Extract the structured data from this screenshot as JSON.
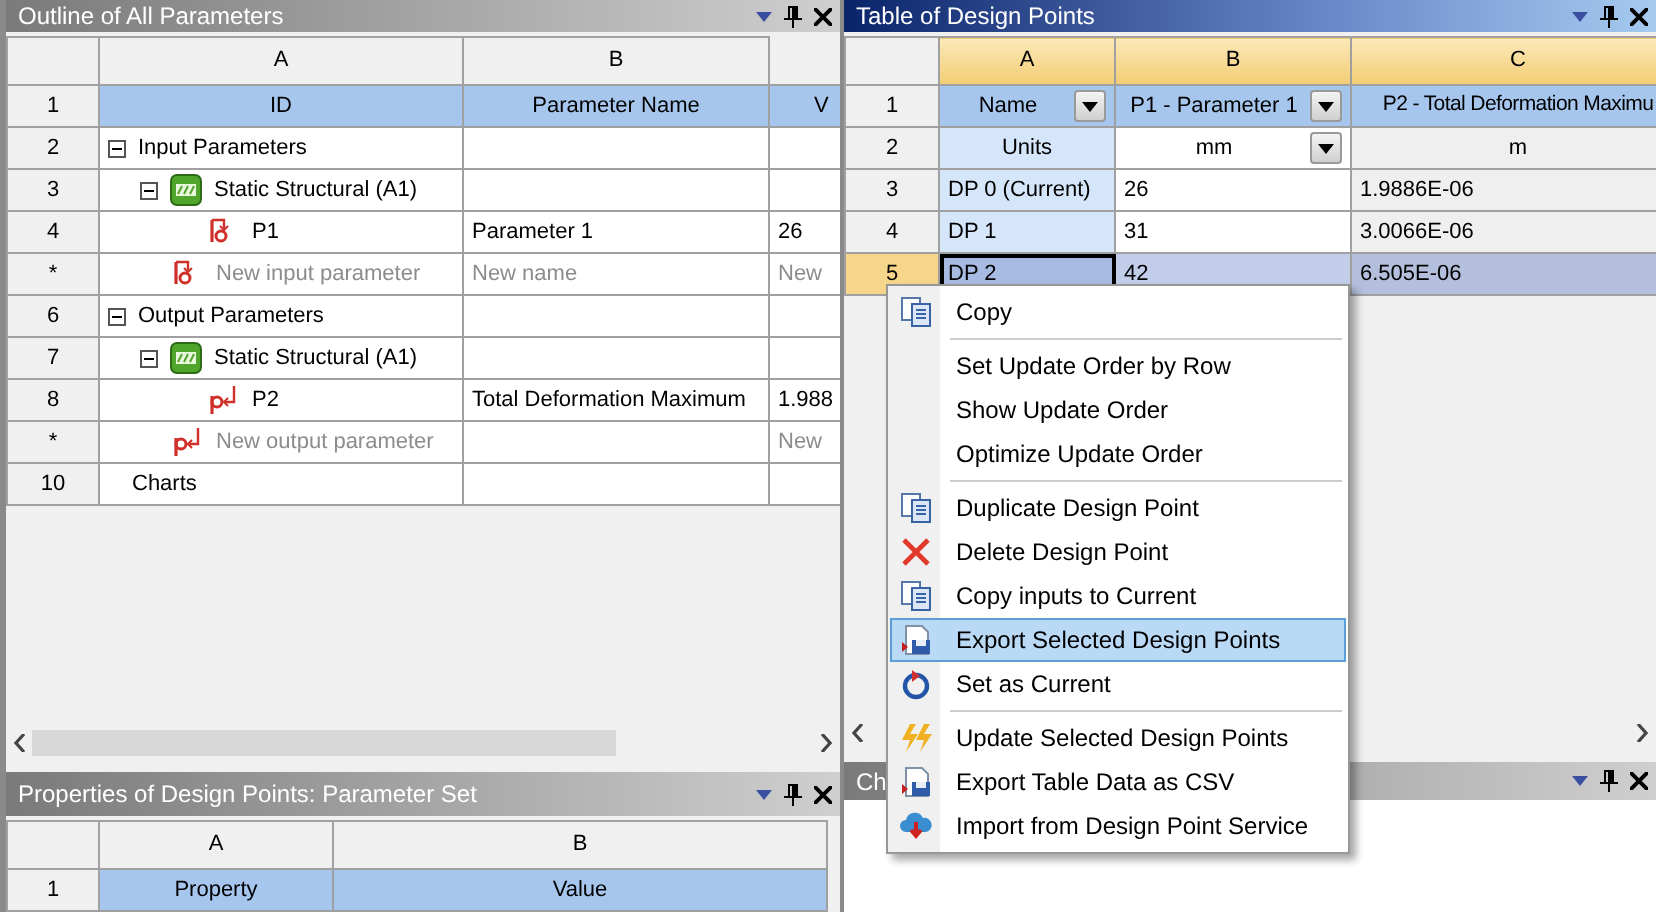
{
  "outline_panel": {
    "title": "Outline of All Parameters",
    "active": false,
    "columns": [
      "A",
      "B"
    ],
    "header_row": {
      "number": "1",
      "cells": [
        "ID",
        "Parameter Name",
        "V"
      ]
    },
    "rows": [
      {
        "number": "2",
        "label": "Input Parameters",
        "kind": "group",
        "expanded": true,
        "children": [
          {
            "number": "3",
            "label": "Static Structural (A1)",
            "kind": "system",
            "expanded": true,
            "children": [
              {
                "number": "4",
                "label": "P1",
                "kind": "input",
                "name": "Parameter 1",
                "value": "26"
              },
              {
                "number": "*",
                "label": "New input parameter",
                "kind": "new_input",
                "name": "New name",
                "value": "New"
              }
            ]
          }
        ]
      },
      {
        "number": "6",
        "label": "Output Parameters",
        "kind": "group",
        "expanded": true,
        "children": [
          {
            "number": "7",
            "label": "Static Structural (A1)",
            "kind": "system",
            "expanded": true,
            "children": [
              {
                "number": "8",
                "label": "P2",
                "kind": "output",
                "name": "Total Deformation Maximum",
                "value": "1.988"
              },
              {
                "number": "*",
                "label": "New output parameter",
                "kind": "new_output",
                "value": "New"
              }
            ]
          }
        ]
      },
      {
        "number": "10",
        "label": "Charts",
        "kind": "plain"
      }
    ]
  },
  "properties_panel": {
    "title": "Properties of Design Points: Parameter Set",
    "active": false,
    "columns": [
      "A",
      "B"
    ],
    "header_row": {
      "number": "1",
      "cells": [
        "Property",
        "Value"
      ]
    }
  },
  "design_points_panel": {
    "title": "Table of Design Points",
    "active": true,
    "columns": [
      "A",
      "B",
      "C"
    ],
    "header_row": {
      "number": "1",
      "cells": [
        {
          "text": "Name",
          "dropdown": true
        },
        {
          "text": "P1 - Parameter 1",
          "dropdown": true
        },
        {
          "text": "P2 - Total Deformation Maximu",
          "dropdown": false
        }
      ]
    },
    "units_row": {
      "number": "2",
      "cells": [
        {
          "text": "Units",
          "dropdown": false
        },
        {
          "text": "mm",
          "dropdown": true
        },
        {
          "text": "m",
          "dropdown": false
        }
      ]
    },
    "rows": [
      {
        "number": "3",
        "name": "DP 0 (Current)",
        "p1": "26",
        "p2": "1.9886E-06",
        "selected": false
      },
      {
        "number": "4",
        "name": "DP 1",
        "p1": "31",
        "p2": "3.0066E-06",
        "selected": false
      },
      {
        "number": "5",
        "name": "DP 2",
        "p1": "42",
        "p2": "6.505E-06",
        "selected": true
      }
    ]
  },
  "charts_panel": {
    "title": "Ch",
    "active": false
  },
  "context_menu": [
    {
      "kind": "copy",
      "label": "Copy",
      "selected": false
    },
    {
      "kind": "separator"
    },
    {
      "kind": "plain",
      "label": "Set Update Order by Row",
      "selected": false
    },
    {
      "kind": "plain",
      "label": "Show Update Order",
      "selected": false
    },
    {
      "kind": "plain",
      "label": "Optimize Update Order",
      "selected": false
    },
    {
      "kind": "separator"
    },
    {
      "kind": "copy",
      "label": "Duplicate Design Point",
      "selected": false
    },
    {
      "kind": "delete",
      "label": "Delete Design Point",
      "selected": false
    },
    {
      "kind": "copy",
      "label": "Copy inputs to Current",
      "selected": false
    },
    {
      "kind": "export",
      "label": "Export Selected Design Points",
      "selected": true
    },
    {
      "kind": "current",
      "label": "Set as Current",
      "selected": false
    },
    {
      "kind": "separator"
    },
    {
      "kind": "update",
      "label": "Update Selected Design Points",
      "selected": false
    },
    {
      "kind": "export",
      "label": "Export Table Data as CSV",
      "selected": false
    },
    {
      "kind": "import",
      "label": "Import from Design Point Service",
      "selected": false
    }
  ]
}
